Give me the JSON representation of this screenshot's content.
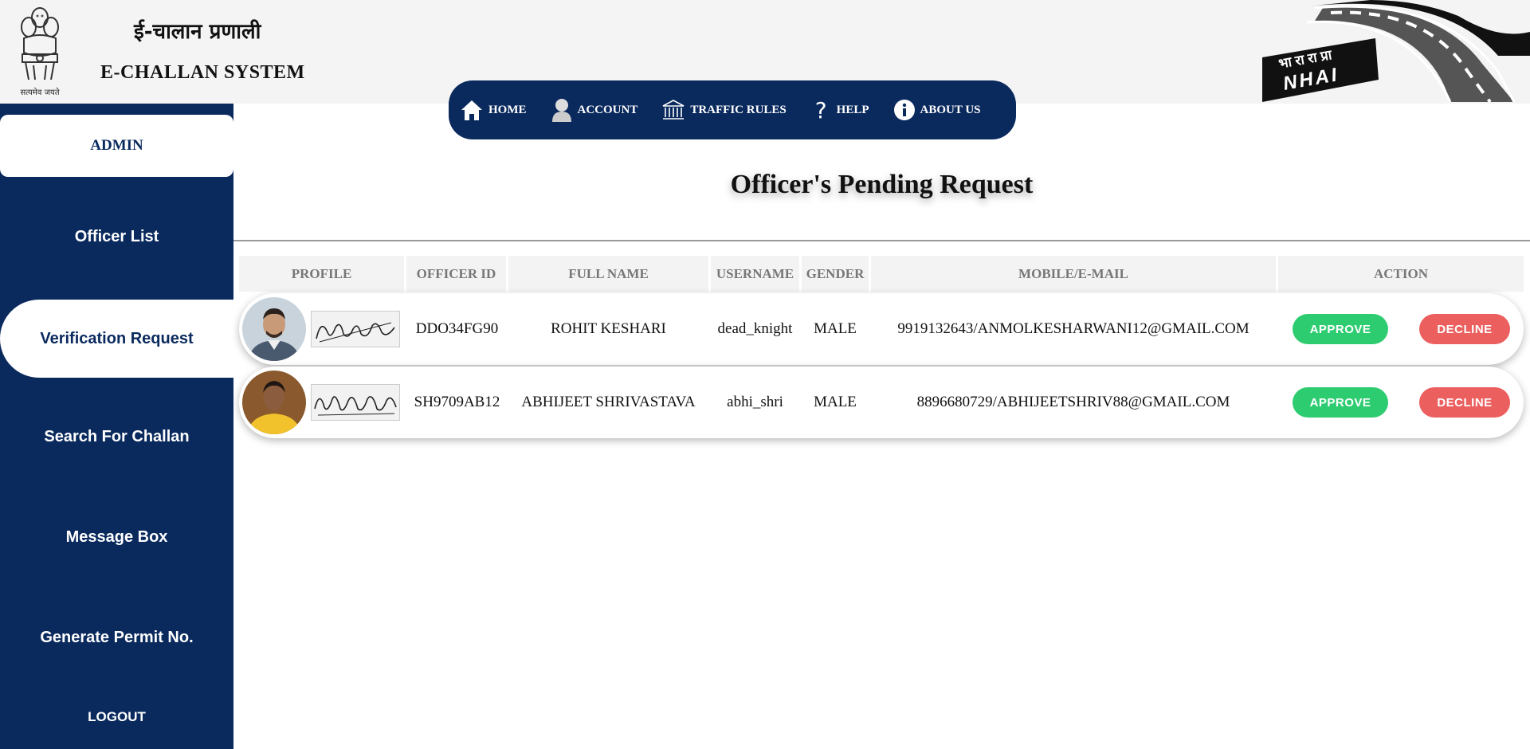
{
  "header": {
    "emblem_motto": "सत्यमेव जयते",
    "title_hindi": "ई-चालान प्रणाली",
    "title_english": "E-CHALLAN SYSTEM",
    "nhai_hindi": "भा रा रा प्रा",
    "nhai_english": "NHAI"
  },
  "nav": {
    "items": [
      {
        "label": "HOME",
        "icon": "home-icon"
      },
      {
        "label": "ACCOUNT",
        "icon": "user-icon"
      },
      {
        "label": "TRAFFIC RULES",
        "icon": "bank-icon"
      },
      {
        "label": "HELP",
        "icon": "question-icon"
      },
      {
        "label": "ABOUT US",
        "icon": "info-icon"
      }
    ]
  },
  "sidebar": {
    "admin_label": "ADMIN",
    "items": [
      {
        "label": "Officer List"
      },
      {
        "label": "Verification Request",
        "active": true
      },
      {
        "label": "Search For Challan"
      },
      {
        "label": "Message Box"
      },
      {
        "label": "Generate Permit No."
      }
    ],
    "logout_label": "LOGOUT"
  },
  "main": {
    "title": "Officer's Pending Request",
    "columns": [
      "PROFILE",
      "OFFICER ID",
      "FULL NAME",
      "USERNAME",
      "GENDER",
      "MOBILE/E-MAIL",
      "ACTION"
    ],
    "rows": [
      {
        "officer_id": "DDO34FG90",
        "full_name": "ROHIT KESHARI",
        "username": "dead_knight",
        "gender": "MALE",
        "contact": "9919132643/ANMOLKESHARWANI12@GMAIL.COM",
        "approve_label": "APPROVE",
        "decline_label": "DECLINE",
        "signature_text": "Rohit Keshari"
      },
      {
        "officer_id": "SH9709AB12",
        "full_name": "ABHIJEET SHRIVASTAVA",
        "username": "abhi_shri",
        "gender": "MALE",
        "contact": "8896680729/ABHIJEETSHRIV88@GMAIL.COM",
        "approve_label": "APPROVE",
        "decline_label": "DECLINE",
        "signature_text": "Abhijeet Shrivastava"
      }
    ]
  },
  "colors": {
    "navy": "#0a2a5e",
    "approve": "#2ecc71",
    "decline": "#ec5f5f",
    "header_bg": "#f4f4f4"
  }
}
